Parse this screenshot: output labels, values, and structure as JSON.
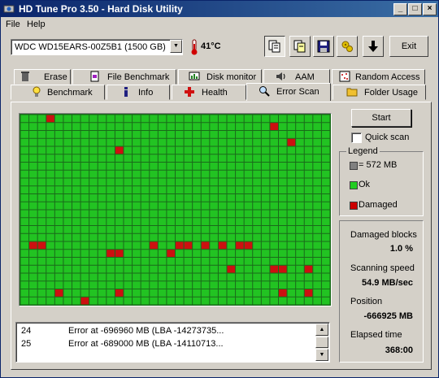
{
  "window": {
    "title": "HD Tune Pro 3.50 - Hard Disk Utility"
  },
  "menu": [
    {
      "label": "File"
    },
    {
      "label": "Help"
    }
  ],
  "toolbar": {
    "drive": "WDC WD15EARS-00Z5B1 (1500 GB)",
    "temperature": "41°C",
    "exit_label": "Exit",
    "icons": [
      "copy-info-icon",
      "copy-text-icon",
      "save-icon",
      "settings-icon",
      "download-icon"
    ]
  },
  "tabs_row1": [
    {
      "label": "Erase",
      "icon": "trash-icon"
    },
    {
      "label": "File Benchmark",
      "icon": "file-benchmark-icon"
    },
    {
      "label": "Disk monitor",
      "icon": "disk-monitor-icon"
    },
    {
      "label": "AAM",
      "icon": "speaker-icon"
    },
    {
      "label": "Random Access",
      "icon": "random-access-icon"
    }
  ],
  "tabs_row2": [
    {
      "label": "Benchmark",
      "icon": "benchmark-icon"
    },
    {
      "label": "Info",
      "icon": "info-icon"
    },
    {
      "label": "Health",
      "icon": "health-cross-icon"
    },
    {
      "label": "Error Scan",
      "icon": "magnifier-icon",
      "active": true
    },
    {
      "label": "Folder Usage",
      "icon": "folder-icon"
    }
  ],
  "scan": {
    "start_label": "Start",
    "quick_scan_label": "Quick scan",
    "quick_scan_checked": false,
    "block_grid": {
      "columns": 36,
      "rows": 24,
      "damaged_blocks": [
        [
          3,
          0
        ],
        [
          29,
          1
        ],
        [
          11,
          4
        ],
        [
          31,
          3
        ],
        [
          1,
          16
        ],
        [
          2,
          16
        ],
        [
          15,
          16
        ],
        [
          18,
          16
        ],
        [
          19,
          16
        ],
        [
          21,
          16
        ],
        [
          23,
          16
        ],
        [
          25,
          16
        ],
        [
          26,
          16
        ],
        [
          10,
          17
        ],
        [
          11,
          17
        ],
        [
          17,
          17
        ],
        [
          24,
          19
        ],
        [
          29,
          19
        ],
        [
          30,
          19
        ],
        [
          33,
          19
        ],
        [
          4,
          22
        ],
        [
          7,
          23
        ],
        [
          11,
          22
        ],
        [
          30,
          22
        ],
        [
          33,
          22
        ]
      ]
    }
  },
  "legend": {
    "title": "Legend",
    "items": [
      {
        "label": "= 572 MB",
        "color": "#808080"
      },
      {
        "label": "Ok",
        "color": "#22cc22"
      },
      {
        "label": "Damaged",
        "color": "#cc0000"
      }
    ]
  },
  "stats": {
    "damaged_blocks_label": "Damaged blocks",
    "damaged_blocks_value": "1.0 %",
    "scanning_speed_label": "Scanning speed",
    "scanning_speed_value": "54.9 MB/sec",
    "position_label": "Position",
    "position_value": "-666925 MB",
    "elapsed_label": "Elapsed time",
    "elapsed_value": "368:00"
  },
  "log": [
    {
      "num": "24",
      "msg": "Error at -696960 MB (LBA -14273735..."
    },
    {
      "num": "25",
      "msg": "Error at -689000 MB (LBA -14110713..."
    }
  ],
  "colors": {
    "ok": "#22c322",
    "damaged": "#cc1010",
    "grid_line": "#0d5a0d"
  }
}
